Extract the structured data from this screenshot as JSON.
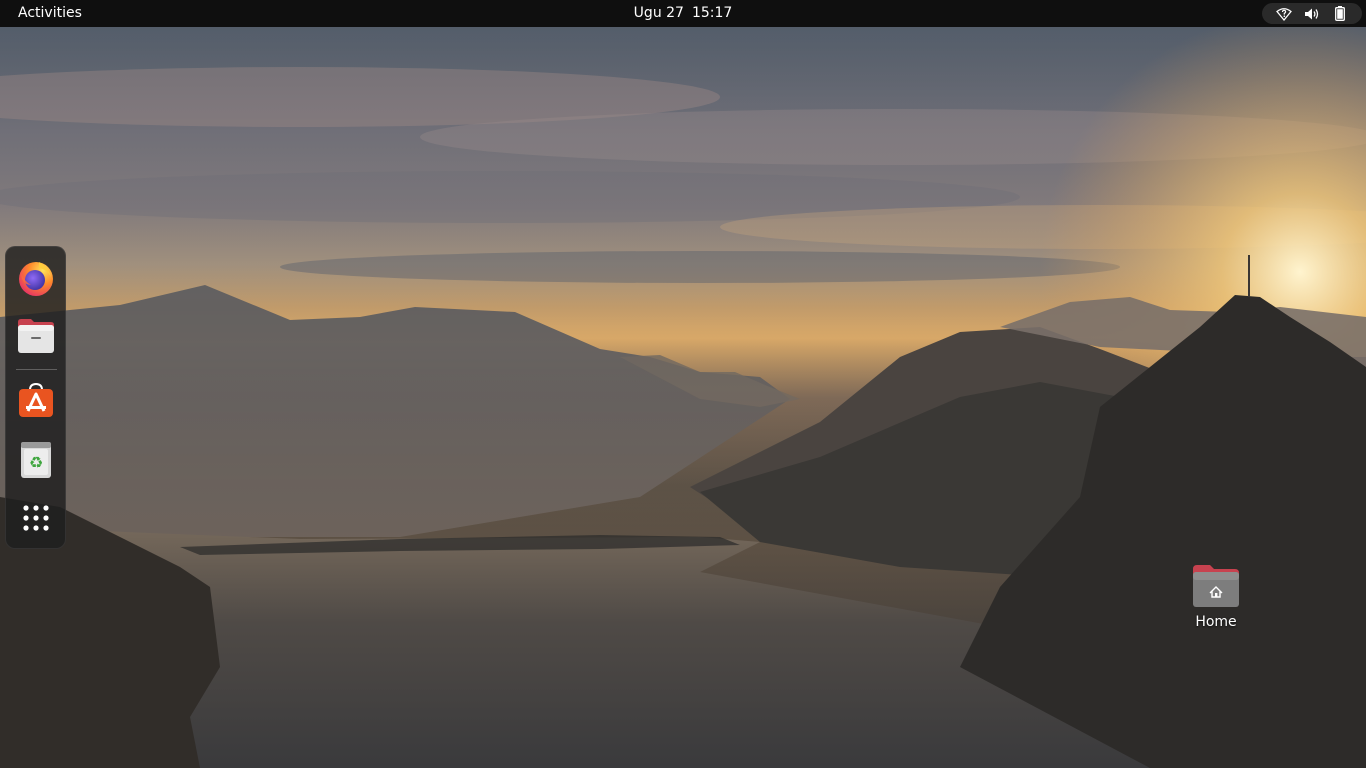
{
  "topbar": {
    "activities_label": "Activities",
    "date": "Ugu 27",
    "time": "15:17",
    "status_icons": [
      "wifi-question-icon",
      "volume-icon",
      "battery-icon"
    ]
  },
  "dock": {
    "items": [
      {
        "name": "Firefox",
        "icon": "firefox-icon"
      },
      {
        "name": "Files",
        "icon": "files-icon"
      },
      {
        "name": "Ubuntu Software",
        "icon": "app-store-icon"
      },
      {
        "name": "Trash",
        "icon": "trash-icon"
      },
      {
        "name": "Show Applications",
        "icon": "app-grid-icon"
      }
    ]
  },
  "desktop": {
    "icons": [
      {
        "label": "Home",
        "icon": "home-folder-icon"
      }
    ]
  },
  "colors": {
    "topbar_bg": "#0f0f0f",
    "accent_orange": "#e95420",
    "folder_red": "#c7424f"
  }
}
